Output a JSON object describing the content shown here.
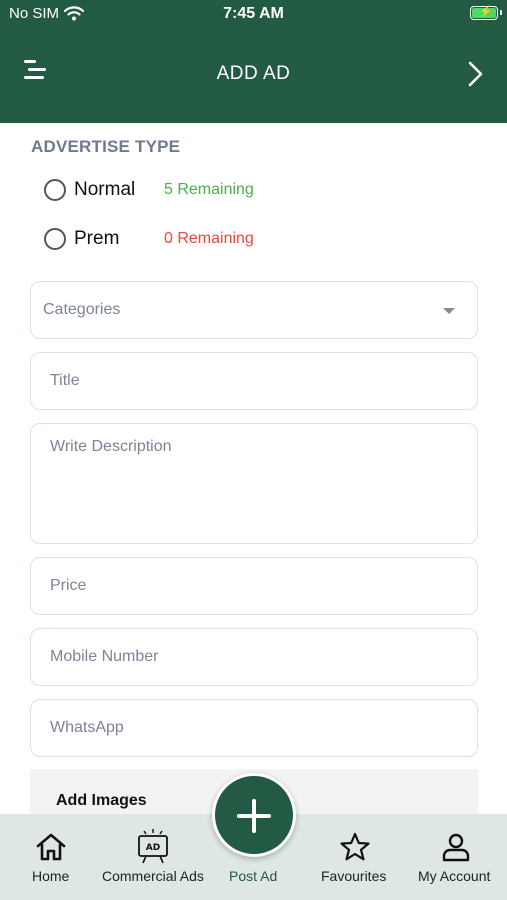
{
  "status_bar": {
    "carrier": "No SIM",
    "time": "7:45 AM"
  },
  "app_bar": {
    "title": "ADD AD"
  },
  "advertise_type": {
    "title": "ADVERTISE TYPE",
    "options": [
      {
        "label": "Normal",
        "remaining": "5 Remaining",
        "color": "#4caf50"
      },
      {
        "label": "Prem",
        "remaining": "0 Remaining",
        "color": "#e8473f"
      }
    ]
  },
  "form": {
    "categories_placeholder": "Categories",
    "title_placeholder": "Title",
    "description_placeholder": "Write Description",
    "price_placeholder": "Price",
    "mobile_placeholder": "Mobile Number",
    "whatsapp_placeholder": "WhatsApp"
  },
  "images": {
    "label": "Add Images"
  },
  "nav": {
    "items": [
      {
        "label": "Home",
        "icon": "home-icon"
      },
      {
        "label": "Commercial Ads",
        "icon": "ad-board-icon",
        "icon_text": "AD"
      },
      {
        "label": "Post Ad",
        "icon": "plus-icon"
      },
      {
        "label": "Favourites",
        "icon": "star-icon"
      },
      {
        "label": "My Account",
        "icon": "person-icon"
      }
    ]
  },
  "colors": {
    "brand": "#225a44",
    "accent_green": "#4caf50",
    "accent_red": "#e8473f"
  }
}
